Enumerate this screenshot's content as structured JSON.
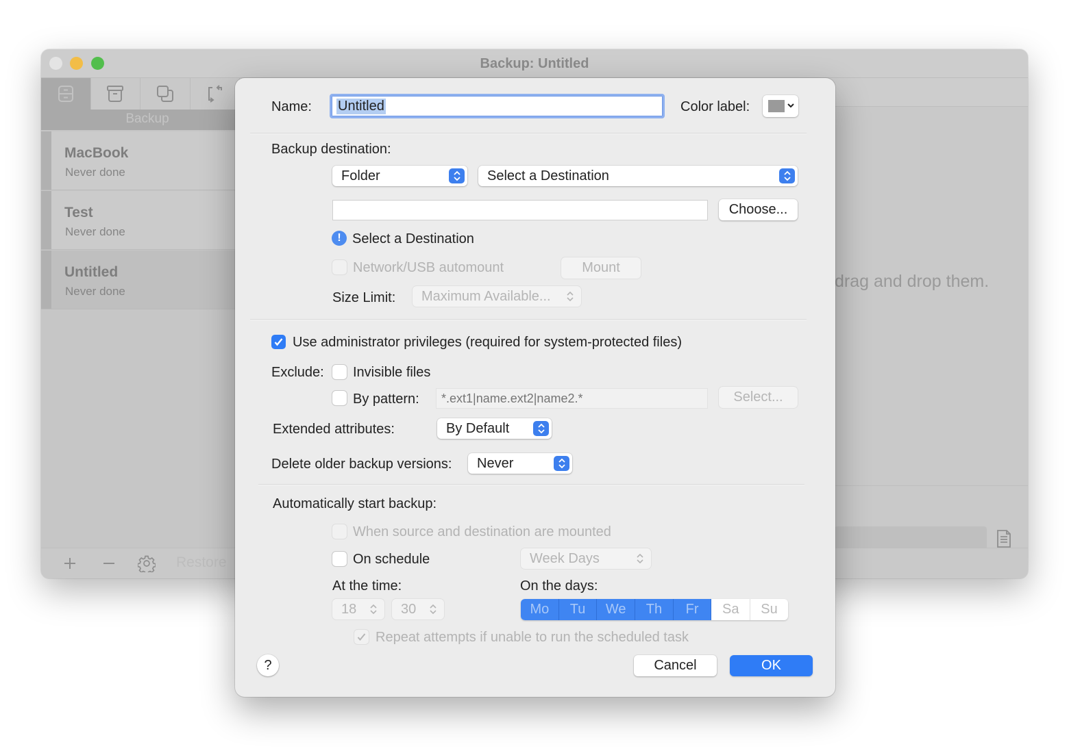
{
  "window": {
    "title": "Backup: Untitled",
    "toolbar_tabs": [
      {
        "icon": "drawer-icon",
        "label": "Backup",
        "active": true
      },
      {
        "icon": "archive-icon",
        "active": false
      },
      {
        "icon": "copy-icon",
        "active": false
      },
      {
        "icon": "sync-icon",
        "active": false
      }
    ],
    "active_tab_label": "Backup",
    "sidebar": {
      "items": [
        {
          "name": "MacBook",
          "status": "Never done",
          "selected": false
        },
        {
          "name": "Test",
          "status": "Never done",
          "selected": false
        },
        {
          "name": "Untitled",
          "status": "Never done",
          "selected": true
        }
      ]
    },
    "bottom_bar": {
      "add_icon": "plus-icon",
      "remove_icon": "minus-icon",
      "settings_icon": "gear-icon",
      "restore_label": "Restore"
    },
    "content_hint": "drag and drop them.",
    "side_icons": [
      "document-icon",
      "alert-icon"
    ]
  },
  "dialog": {
    "name_label": "Name:",
    "name_value": "Untitled",
    "color_label": "Color label:",
    "color_value": "#9a9a9a",
    "destination": {
      "label": "Backup destination:",
      "type_value": "Folder",
      "target_value": "Select a Destination",
      "path_value": "",
      "choose_label": "Choose...",
      "warning_text": "Select a Destination",
      "automount_label": "Network/USB automount",
      "automount_checked": false,
      "mount_label": "Mount",
      "size_limit_label": "Size Limit:",
      "size_limit_value": "Maximum Available..."
    },
    "admin_privileges": {
      "label": "Use administrator privileges (required for system-protected files)",
      "checked": true
    },
    "exclude": {
      "label": "Exclude:",
      "invisible_label": "Invisible files",
      "invisible_checked": false,
      "pattern_label": "By pattern:",
      "pattern_checked": false,
      "pattern_placeholder": "*.ext1|name.ext2|name2.*",
      "select_label": "Select..."
    },
    "extended_attributes": {
      "label": "Extended attributes:",
      "value": "By Default"
    },
    "delete_older": {
      "label": "Delete older backup versions:",
      "value": "Never"
    },
    "auto_start": {
      "label": "Automatically start backup:",
      "when_mounted_label": "When source and destination are mounted",
      "when_mounted_checked": false,
      "schedule_label": "On schedule",
      "schedule_checked": false,
      "schedule_mode": "Week Days",
      "time_label": "At the time:",
      "hour": "18",
      "minute": "30",
      "days_label": "On the days:",
      "days": [
        {
          "label": "Mo",
          "selected": true
        },
        {
          "label": "Tu",
          "selected": true
        },
        {
          "label": "We",
          "selected": true
        },
        {
          "label": "Th",
          "selected": true
        },
        {
          "label": "Fr",
          "selected": true
        },
        {
          "label": "Sa",
          "selected": false
        },
        {
          "label": "Su",
          "selected": false
        }
      ],
      "repeat_label": "Repeat attempts if unable to run the scheduled task",
      "repeat_checked": true
    },
    "help_label": "?",
    "cancel_label": "Cancel",
    "ok_label": "OK",
    "accent_color": "#2f7cf6"
  }
}
